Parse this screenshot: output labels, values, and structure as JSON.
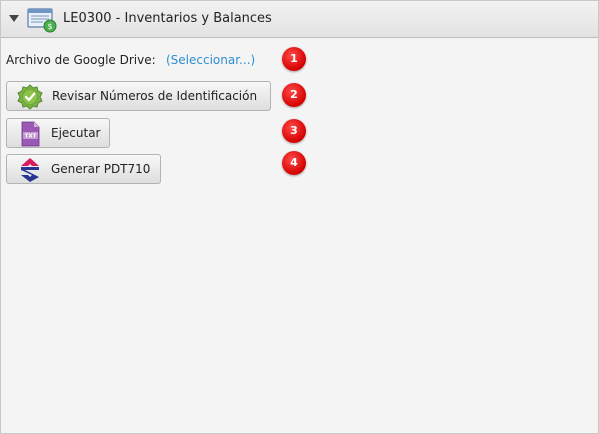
{
  "panel": {
    "title": "LE0300 - Inventarios y Balances"
  },
  "drive": {
    "label": "Archivo de Google Drive:",
    "link_text": "(Seleccionar...)"
  },
  "buttons": [
    {
      "label": "Revisar Números de Identificación",
      "icon": "check-badge-icon"
    },
    {
      "label": "Ejecutar",
      "icon": "txt-file-icon"
    },
    {
      "label": "Generar PDT710",
      "icon": "sunat-logo-icon"
    }
  ],
  "badges": [
    "1",
    "2",
    "3",
    "4"
  ],
  "colors": {
    "link": "#2f8fd0",
    "badge": "#d40000"
  }
}
